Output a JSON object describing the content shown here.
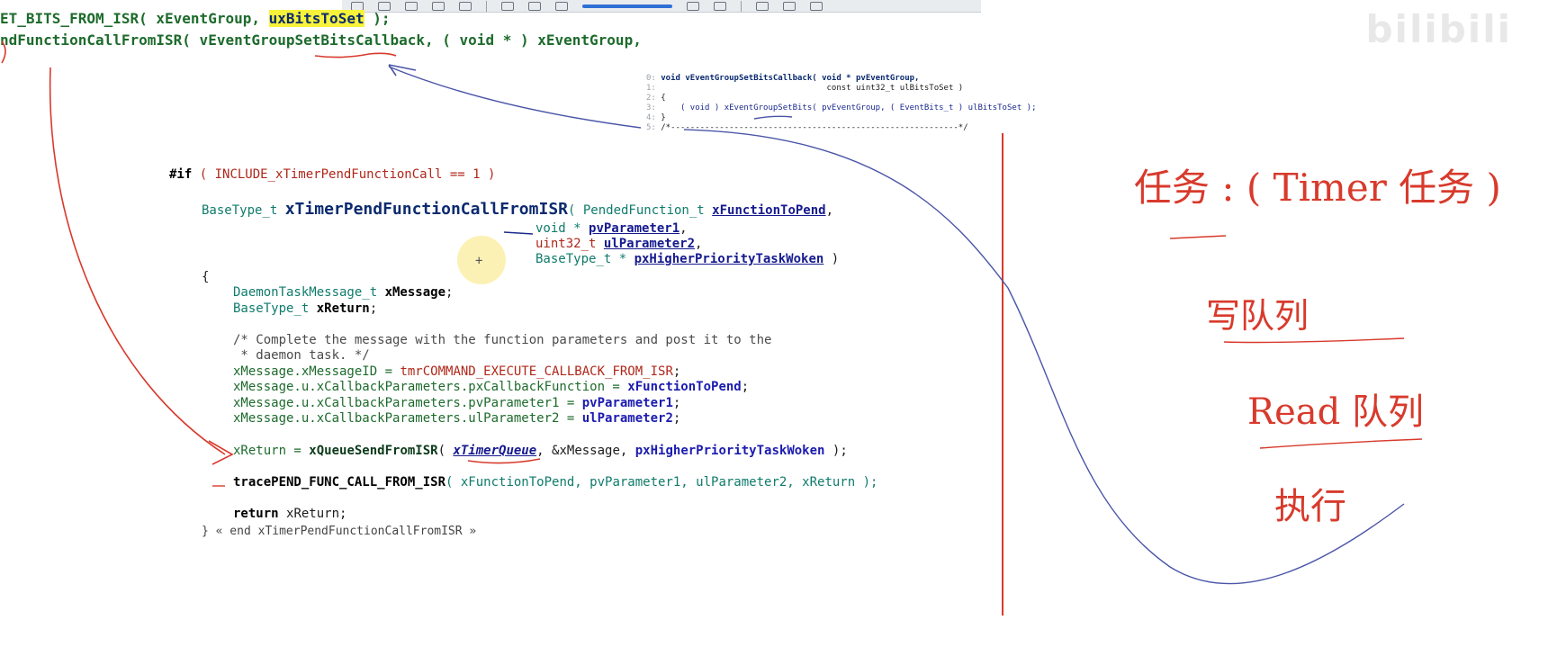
{
  "watermark": "bilibili",
  "top_code": {
    "line1_prefix": "ET_BITS_FROM_ISR( xEventGroup, ",
    "line1_highlight": "uxBitsToSet",
    "line1_suffix": " );",
    "line2": "ndFunctionCallFromISR( vEventGroupSetBitsCallback, ( void * ) xEventGroup,"
  },
  "snippet": {
    "lines": [
      {
        "num": "0:",
        "text": "void vEventGroupSetBitsCallback( void * pvEventGroup,"
      },
      {
        "num": "1:",
        "text": "                                  const uint32_t ulBitsToSet )"
      },
      {
        "num": "2:",
        "text": "{"
      },
      {
        "num": "3:",
        "text": "    ( void ) xEventGroupSetBits( pvEventGroup, ( EventBits_t ) ulBitsToSet );"
      },
      {
        "num": "4:",
        "text": "}"
      },
      {
        "num": "5:",
        "text": "/*-----------------------------------------------------------*/"
      }
    ]
  },
  "code": {
    "if_kw": "#if",
    "if_cond": " ( INCLUDE_xTimerPendFunctionCall == 1 )",
    "sig_type": "BaseType_t ",
    "sig_name": "xTimerPendFunctionCallFromISR",
    "sig_p1_open": "( PendedFunction_t ",
    "sig_p1": "xFunctionToPend",
    "sig_p1_close": ",",
    "sig_p2_type": "void * ",
    "sig_p2": "pvParameter1",
    "sig_p3_type": "uint32_t ",
    "sig_p3": "ulParameter2",
    "sig_p4_type": "BaseType_t * ",
    "sig_p4": "pxHigherPriorityTaskWoken",
    "sig_close": " )",
    "open_brace": "{",
    "decl1_type": "DaemonTaskMessage_t ",
    "decl1_var": "xMessage",
    "decl2_type": "BaseType_t ",
    "decl2_var": "xReturn",
    "comment1": "/* Complete the message with the function parameters and post it to the",
    "comment2": " * daemon task. */",
    "assign1_lhs": "xMessage.xMessageID = ",
    "assign1_rhs": "tmrCOMMAND_EXECUTE_CALLBACK_FROM_ISR",
    "assign2_lhs": "xMessage.u.xCallbackParameters.pxCallbackFunction = ",
    "assign2_rhs": "xFunctionToPend",
    "assign3_lhs": "xMessage.u.xCallbackParameters.pvParameter1 = ",
    "assign3_rhs": "pvParameter1",
    "assign4_lhs": "xMessage.u.xCallbackParameters.ulParameter2 = ",
    "assign4_rhs": "ulParameter2",
    "send_lhs": "xReturn = ",
    "send_fn": "xQueueSendFromISR",
    "send_open": "( ",
    "send_queue": "xTimerQueue",
    "send_rest": ", &xMessage, ",
    "send_woken": "pxHigherPriorityTaskWoken",
    "send_close": " );",
    "trace_fn": "tracePEND_FUNC_CALL_FROM_ISR",
    "trace_args": "( xFunctionToPend, pvParameter1, ulParameter2, xReturn );",
    "return_kw": "return ",
    "return_val": "xReturn;",
    "close_line": "} « end xTimerPendFunctionCallFromISR »"
  },
  "handwriting": {
    "line1": "任务 : ( Timer 任务 )",
    "line2": "写队列",
    "line3": "Read 队列",
    "line4": "执行"
  },
  "colors": {
    "pen_red": "#d83a2c",
    "pen_blue": "#4a55a8",
    "highlight": "#f7f23a"
  }
}
